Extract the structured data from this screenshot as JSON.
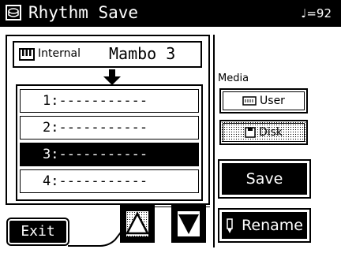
{
  "header": {
    "title": "Rhythm Save",
    "tempo": "♩=92",
    "icon": "drum-icon"
  },
  "source": {
    "label": "Internal",
    "song": "Mambo 3",
    "icon": "keyboard-icon"
  },
  "slots": [
    {
      "label": "1:-----------",
      "selected": false
    },
    {
      "label": "2:-----------",
      "selected": false
    },
    {
      "label": "3:-----------",
      "selected": true
    },
    {
      "label": "4:-----------",
      "selected": false
    }
  ],
  "media": {
    "label": "Media",
    "user_label": "User",
    "disk_label": "Disk",
    "selected": "Disk"
  },
  "actions": {
    "save_label": "Save",
    "rename_label": "Rename",
    "exit_label": "Exit"
  },
  "colors": {
    "foreground": "#000000",
    "background": "#ffffff"
  }
}
